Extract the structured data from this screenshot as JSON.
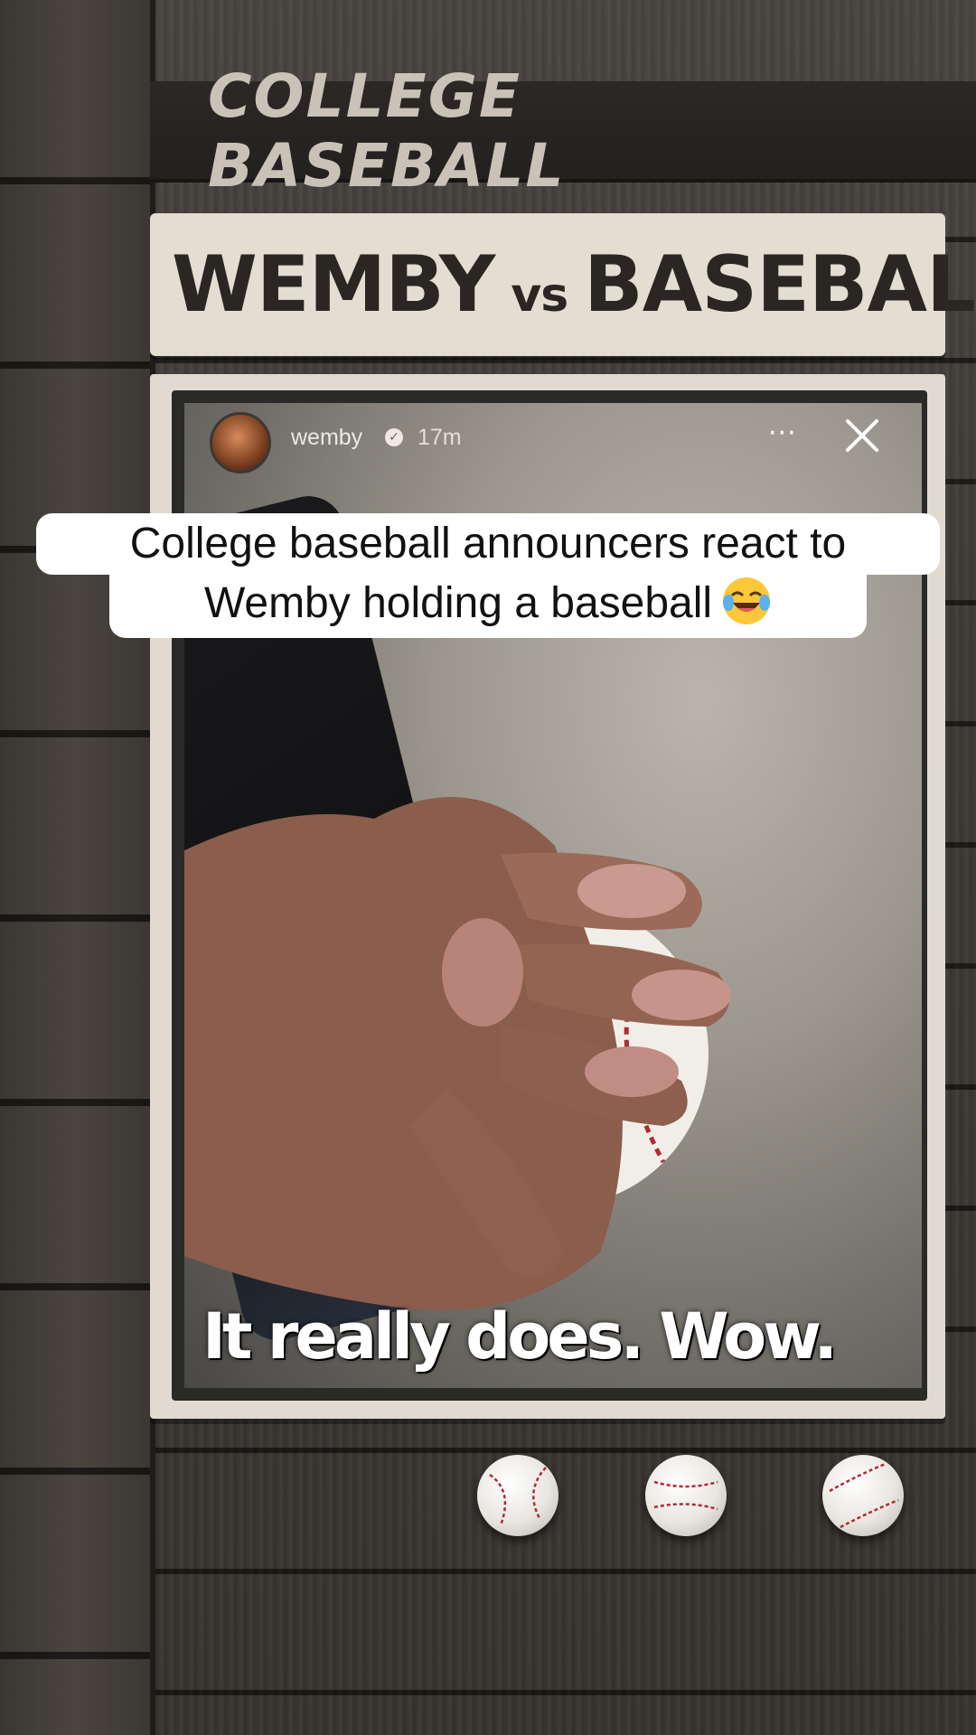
{
  "header": {
    "title": "COLLEGE BASEBALL"
  },
  "title_card": {
    "left": "WEMBY",
    "vs": "vs",
    "right": "BASEBALL"
  },
  "story": {
    "username": "wemby",
    "time": "17m",
    "more_label": "···",
    "close_label": "✕"
  },
  "overlay_caption": {
    "line1": "College baseball announcers react to",
    "line2": "Wemby holding a baseball",
    "emoji": "face-with-tears-of-joy-icon"
  },
  "video_caption": "It really does. Wow.",
  "colors": {
    "card": "#e3ddd2",
    "wood": "#3d3935",
    "caption_bg": "#ffffff"
  }
}
